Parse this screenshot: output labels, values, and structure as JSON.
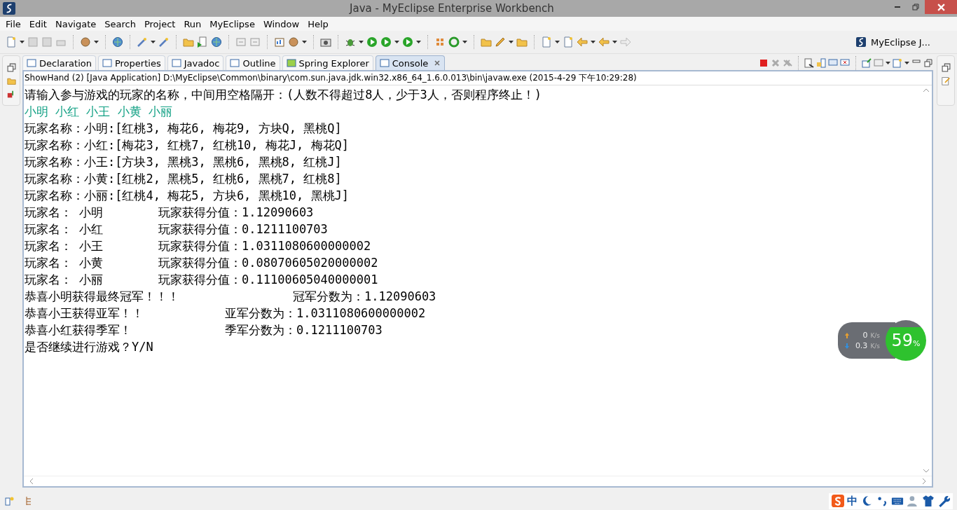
{
  "window": {
    "title": "Java - MyEclipse Enterprise Workbench"
  },
  "menu": [
    "File",
    "Edit",
    "Navigate",
    "Search",
    "Project",
    "Run",
    "MyEclipse",
    "Window",
    "Help"
  ],
  "perspective": {
    "label": "MyEclipse J..."
  },
  "tabs": [
    {
      "label": "Declaration",
      "selected": false
    },
    {
      "label": "Properties",
      "selected": false
    },
    {
      "label": "Javadoc",
      "selected": false
    },
    {
      "label": "Outline",
      "selected": false
    },
    {
      "label": "Spring Explorer",
      "selected": false
    },
    {
      "label": "Console",
      "selected": true
    }
  ],
  "console": {
    "process": "ShowHand (2) [Java Application] D:\\MyEclipse\\Common\\binary\\com.sun.java.jdk.win32.x86_64_1.6.0.013\\bin\\javaw.exe (2015-4-29 下午10:29:28)",
    "lines": [
      {
        "kind": "output",
        "texts": [
          "请输入参与游戏的玩家的名称，中间用空格隔开：(人数不得超过8人，少于3人，否则程序终止！)"
        ]
      },
      {
        "kind": "input",
        "texts": [
          "小明 小红 小王 小黄 小丽"
        ]
      },
      {
        "kind": "output",
        "texts": [
          "玩家名称：小明:[红桃3, 梅花6, 梅花9, 方块Q, 黑桃Q]"
        ]
      },
      {
        "kind": "output",
        "texts": [
          "玩家名称：小红:[梅花3, 红桃7, 红桃10, 梅花J, 梅花Q]"
        ]
      },
      {
        "kind": "output",
        "texts": [
          "玩家名称：小王:[方块3, 黑桃3, 黑桃6, 黑桃8, 红桃J]"
        ]
      },
      {
        "kind": "output",
        "texts": [
          "玩家名称：小黄:[红桃2, 黑桃5, 红桃6, 黑桃7, 红桃8]"
        ]
      },
      {
        "kind": "output",
        "texts": [
          "玩家名称：小丽:[红桃4, 梅花5, 方块6, 黑桃10, 黑桃J]"
        ]
      },
      {
        "kind": "score",
        "texts": [
          "玩家名： 小明",
          "玩家获得分值：1.12090603"
        ]
      },
      {
        "kind": "score",
        "texts": [
          "玩家名： 小红",
          "玩家获得分值：0.1211100703"
        ]
      },
      {
        "kind": "score",
        "texts": [
          "玩家名： 小王",
          "玩家获得分值：1.0311080600000002"
        ]
      },
      {
        "kind": "score",
        "texts": [
          "玩家名： 小黄",
          "玩家获得分值：0.08070605020000002"
        ]
      },
      {
        "kind": "score",
        "texts": [
          "玩家名： 小丽",
          "玩家获得分值：0.11100605040000001"
        ]
      },
      {
        "kind": "champion",
        "texts": [
          "恭喜小明获得最终冠军！！！",
          "冠军分数为：1.12090603"
        ]
      },
      {
        "kind": "placing",
        "texts": [
          "恭喜小王获得亚军！！",
          "亚军分数为：1.0311080600000002"
        ]
      },
      {
        "kind": "placing",
        "texts": [
          "恭喜小红获得季军！",
          "季军分数为：0.1211100703"
        ]
      },
      {
        "kind": "output",
        "texts": [
          "是否继续进行游戏？Y/N"
        ]
      }
    ]
  },
  "network_widget": {
    "upload": "0",
    "download": "0.3",
    "upload_unit": "K/s",
    "download_unit": "K/s",
    "percent": "59",
    "percent_sign": "%"
  },
  "ime": {
    "label": "中"
  }
}
